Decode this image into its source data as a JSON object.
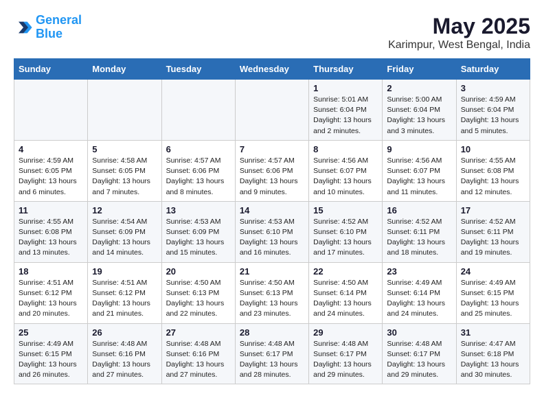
{
  "header": {
    "logo_line1": "General",
    "logo_line2": "Blue",
    "month": "May 2025",
    "location": "Karimpur, West Bengal, India"
  },
  "weekdays": [
    "Sunday",
    "Monday",
    "Tuesday",
    "Wednesday",
    "Thursday",
    "Friday",
    "Saturday"
  ],
  "weeks": [
    [
      {
        "day": "",
        "sunrise": "",
        "sunset": "",
        "daylight": ""
      },
      {
        "day": "",
        "sunrise": "",
        "sunset": "",
        "daylight": ""
      },
      {
        "day": "",
        "sunrise": "",
        "sunset": "",
        "daylight": ""
      },
      {
        "day": "",
        "sunrise": "",
        "sunset": "",
        "daylight": ""
      },
      {
        "day": "1",
        "sunrise": "Sunrise: 5:01 AM",
        "sunset": "Sunset: 6:04 PM",
        "daylight": "Daylight: 13 hours and 2 minutes."
      },
      {
        "day": "2",
        "sunrise": "Sunrise: 5:00 AM",
        "sunset": "Sunset: 6:04 PM",
        "daylight": "Daylight: 13 hours and 3 minutes."
      },
      {
        "day": "3",
        "sunrise": "Sunrise: 4:59 AM",
        "sunset": "Sunset: 6:04 PM",
        "daylight": "Daylight: 13 hours and 5 minutes."
      }
    ],
    [
      {
        "day": "4",
        "sunrise": "Sunrise: 4:59 AM",
        "sunset": "Sunset: 6:05 PM",
        "daylight": "Daylight: 13 hours and 6 minutes."
      },
      {
        "day": "5",
        "sunrise": "Sunrise: 4:58 AM",
        "sunset": "Sunset: 6:05 PM",
        "daylight": "Daylight: 13 hours and 7 minutes."
      },
      {
        "day": "6",
        "sunrise": "Sunrise: 4:57 AM",
        "sunset": "Sunset: 6:06 PM",
        "daylight": "Daylight: 13 hours and 8 minutes."
      },
      {
        "day": "7",
        "sunrise": "Sunrise: 4:57 AM",
        "sunset": "Sunset: 6:06 PM",
        "daylight": "Daylight: 13 hours and 9 minutes."
      },
      {
        "day": "8",
        "sunrise": "Sunrise: 4:56 AM",
        "sunset": "Sunset: 6:07 PM",
        "daylight": "Daylight: 13 hours and 10 minutes."
      },
      {
        "day": "9",
        "sunrise": "Sunrise: 4:56 AM",
        "sunset": "Sunset: 6:07 PM",
        "daylight": "Daylight: 13 hours and 11 minutes."
      },
      {
        "day": "10",
        "sunrise": "Sunrise: 4:55 AM",
        "sunset": "Sunset: 6:08 PM",
        "daylight": "Daylight: 13 hours and 12 minutes."
      }
    ],
    [
      {
        "day": "11",
        "sunrise": "Sunrise: 4:55 AM",
        "sunset": "Sunset: 6:08 PM",
        "daylight": "Daylight: 13 hours and 13 minutes."
      },
      {
        "day": "12",
        "sunrise": "Sunrise: 4:54 AM",
        "sunset": "Sunset: 6:09 PM",
        "daylight": "Daylight: 13 hours and 14 minutes."
      },
      {
        "day": "13",
        "sunrise": "Sunrise: 4:53 AM",
        "sunset": "Sunset: 6:09 PM",
        "daylight": "Daylight: 13 hours and 15 minutes."
      },
      {
        "day": "14",
        "sunrise": "Sunrise: 4:53 AM",
        "sunset": "Sunset: 6:10 PM",
        "daylight": "Daylight: 13 hours and 16 minutes."
      },
      {
        "day": "15",
        "sunrise": "Sunrise: 4:52 AM",
        "sunset": "Sunset: 6:10 PM",
        "daylight": "Daylight: 13 hours and 17 minutes."
      },
      {
        "day": "16",
        "sunrise": "Sunrise: 4:52 AM",
        "sunset": "Sunset: 6:11 PM",
        "daylight": "Daylight: 13 hours and 18 minutes."
      },
      {
        "day": "17",
        "sunrise": "Sunrise: 4:52 AM",
        "sunset": "Sunset: 6:11 PM",
        "daylight": "Daylight: 13 hours and 19 minutes."
      }
    ],
    [
      {
        "day": "18",
        "sunrise": "Sunrise: 4:51 AM",
        "sunset": "Sunset: 6:12 PM",
        "daylight": "Daylight: 13 hours and 20 minutes."
      },
      {
        "day": "19",
        "sunrise": "Sunrise: 4:51 AM",
        "sunset": "Sunset: 6:12 PM",
        "daylight": "Daylight: 13 hours and 21 minutes."
      },
      {
        "day": "20",
        "sunrise": "Sunrise: 4:50 AM",
        "sunset": "Sunset: 6:13 PM",
        "daylight": "Daylight: 13 hours and 22 minutes."
      },
      {
        "day": "21",
        "sunrise": "Sunrise: 4:50 AM",
        "sunset": "Sunset: 6:13 PM",
        "daylight": "Daylight: 13 hours and 23 minutes."
      },
      {
        "day": "22",
        "sunrise": "Sunrise: 4:50 AM",
        "sunset": "Sunset: 6:14 PM",
        "daylight": "Daylight: 13 hours and 24 minutes."
      },
      {
        "day": "23",
        "sunrise": "Sunrise: 4:49 AM",
        "sunset": "Sunset: 6:14 PM",
        "daylight": "Daylight: 13 hours and 24 minutes."
      },
      {
        "day": "24",
        "sunrise": "Sunrise: 4:49 AM",
        "sunset": "Sunset: 6:15 PM",
        "daylight": "Daylight: 13 hours and 25 minutes."
      }
    ],
    [
      {
        "day": "25",
        "sunrise": "Sunrise: 4:49 AM",
        "sunset": "Sunset: 6:15 PM",
        "daylight": "Daylight: 13 hours and 26 minutes."
      },
      {
        "day": "26",
        "sunrise": "Sunrise: 4:48 AM",
        "sunset": "Sunset: 6:16 PM",
        "daylight": "Daylight: 13 hours and 27 minutes."
      },
      {
        "day": "27",
        "sunrise": "Sunrise: 4:48 AM",
        "sunset": "Sunset: 6:16 PM",
        "daylight": "Daylight: 13 hours and 27 minutes."
      },
      {
        "day": "28",
        "sunrise": "Sunrise: 4:48 AM",
        "sunset": "Sunset: 6:17 PM",
        "daylight": "Daylight: 13 hours and 28 minutes."
      },
      {
        "day": "29",
        "sunrise": "Sunrise: 4:48 AM",
        "sunset": "Sunset: 6:17 PM",
        "daylight": "Daylight: 13 hours and 29 minutes."
      },
      {
        "day": "30",
        "sunrise": "Sunrise: 4:48 AM",
        "sunset": "Sunset: 6:17 PM",
        "daylight": "Daylight: 13 hours and 29 minutes."
      },
      {
        "day": "31",
        "sunrise": "Sunrise: 4:47 AM",
        "sunset": "Sunset: 6:18 PM",
        "daylight": "Daylight: 13 hours and 30 minutes."
      }
    ]
  ]
}
